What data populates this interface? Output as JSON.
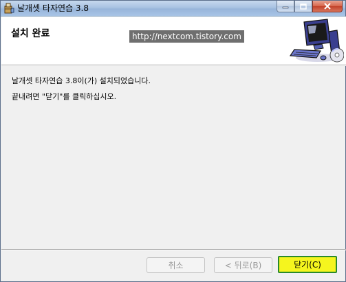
{
  "window": {
    "title": "날개셋 타자연습 3.8",
    "icon": "installer-package-icon"
  },
  "banner": {
    "title": "설치 완료",
    "url_watermark": "http://nextcom.tistory.com",
    "art_icon": "computer-with-cd-icon"
  },
  "body": {
    "line1": "날개셋 타자연습 3.8이(가) 설치되었습니다.",
    "line2": "끝내려면 \"닫기\"를 클릭하십시오."
  },
  "buttons": {
    "cancel": "취소",
    "back": "< 뒤로(B)",
    "close": "닫기(C)"
  },
  "colors": {
    "close_highlight": "#f5f51e",
    "close_border": "#2a8a2a",
    "url_badge_bg": "#6f6f6f"
  }
}
